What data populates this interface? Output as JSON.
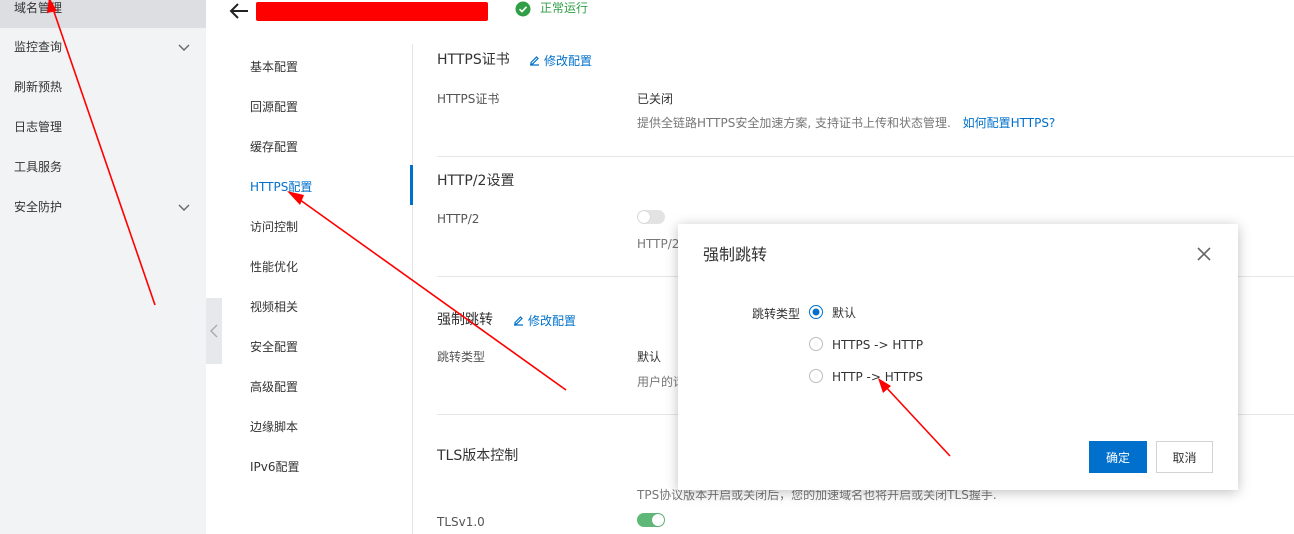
{
  "leftnav": {
    "items": [
      {
        "label": "域名管理",
        "active": true
      },
      {
        "label": "监控查询",
        "expandable": true
      },
      {
        "label": "刷新预热"
      },
      {
        "label": "日志管理"
      },
      {
        "label": "工具服务"
      },
      {
        "label": "安全防护",
        "expandable": true
      }
    ]
  },
  "header": {
    "status_text": "正常运行"
  },
  "submenu": {
    "items": [
      "基本配置",
      "回源配置",
      "缓存配置",
      "HTTPS配置",
      "访问控制",
      "性能优化",
      "视频相关",
      "安全配置",
      "高级配置",
      "边缘脚本",
      "IPv6配置"
    ],
    "active": "HTTPS配置"
  },
  "content": {
    "https_cert": {
      "title": "HTTPS证书",
      "edit_label": "修改配置",
      "field_label": "HTTPS证书",
      "value": "已关闭",
      "desc": "提供全链路HTTPS安全加速方案, 支持证书上传和状态管理.",
      "help_link": "如何配置HTTPS?"
    },
    "http2": {
      "title": "HTTP/2设置",
      "field_label": "HTTP/2",
      "desc_partial": "HTTP/2:"
    },
    "redirect": {
      "title": "强制跳转",
      "edit_label": "修改配置",
      "field_label": "跳转类型",
      "value": "默认",
      "desc_partial": "用户的请"
    },
    "tls": {
      "title": "TLS版本控制",
      "desc": "TPS协议版本开启或关闭后，您的加速域名也将开启或关闭TLS握手.",
      "field_label": "TLSv1.0"
    }
  },
  "dialog": {
    "title": "强制跳转",
    "radio_label": "跳转类型",
    "options": [
      {
        "label": "默认",
        "checked": true
      },
      {
        "label": "HTTPS -> HTTP",
        "checked": false
      },
      {
        "label": "HTTP -> HTTPS",
        "checked": false
      }
    ],
    "ok_label": "确定",
    "cancel_label": "取消"
  },
  "colors": {
    "accent": "#0070cc",
    "status_green": "#2f9e47",
    "redaction": "#ff0000",
    "annotation_arrow": "#ff0000"
  }
}
